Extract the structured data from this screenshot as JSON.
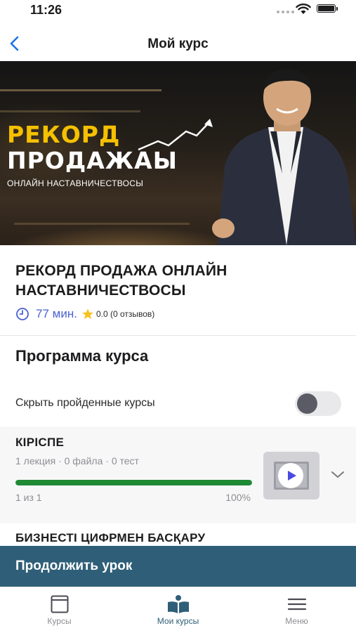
{
  "status_bar": {
    "time": "11:26"
  },
  "nav": {
    "title": "Мой курс",
    "back_icon": "chevron-left-icon"
  },
  "banner": {
    "title_line1": "РЕКОРД",
    "title_line2": "ПРОДАЖАЫ",
    "subtitle": "ОНЛАЙН НАСТАВНИЧЕСТВОСЫ",
    "accent_color": "#f5c000"
  },
  "course": {
    "title": "РЕКОРД ПРОДАЖА ОНЛАЙН НАСТАВНИЧЕСТВОСЫ",
    "duration": "77 мин.",
    "rating": "0.0 (0 отзывов)",
    "duration_color": "#4a62d0"
  },
  "program": {
    "title": "Программа курса",
    "hide_completed_label": "Скрыть пройденные курсы",
    "hide_completed_on": false
  },
  "sections": [
    {
      "title": "КІРІСПЕ",
      "meta": "1 лекция · 0 файла · 0 тест",
      "progress_label": "1 из 1",
      "progress_percent": "100%",
      "progress_value": 1.0,
      "progress_color": "#1f8a34"
    },
    {
      "title": "БИЗНЕСТІ ЦИФРМЕН БАСҚАРУ"
    }
  ],
  "cta": {
    "label": "Продолжить урок",
    "color": "#2f5f78"
  },
  "tabbar": {
    "items": [
      {
        "label": "Курсы",
        "icon": "square-icon",
        "active": false
      },
      {
        "label": "Мои курсы",
        "icon": "open-book-icon",
        "active": true
      },
      {
        "label": "Меню",
        "icon": "menu-icon",
        "active": false
      }
    ]
  }
}
